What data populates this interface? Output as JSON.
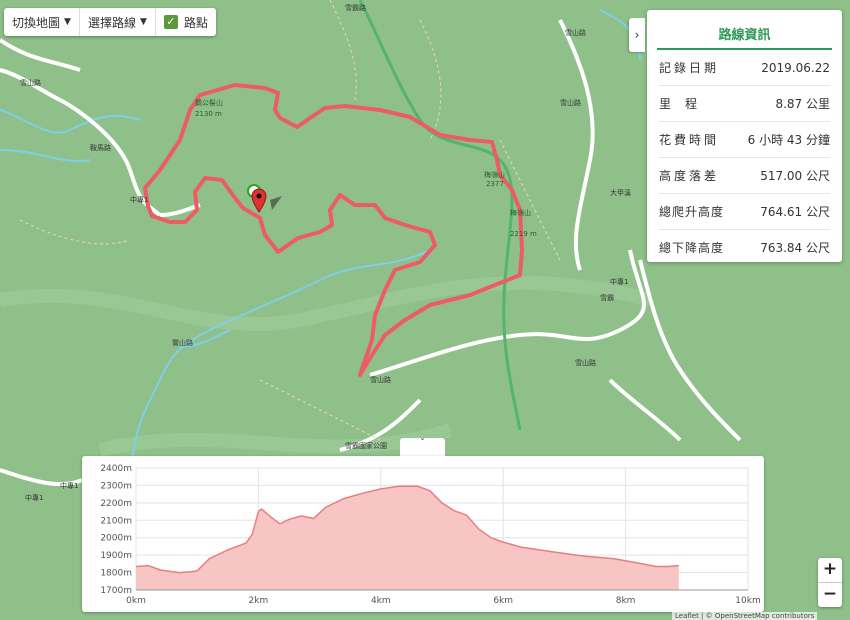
{
  "toolbar": {
    "switch_map": "切換地圖",
    "select_route": "選擇路線",
    "waypoints": "路點"
  },
  "panel": {
    "toggle": "›",
    "title": "路線資訊",
    "rows": [
      {
        "label": "記錄日期",
        "value": "2019.06.22"
      },
      {
        "label": "里程",
        "value": "8.87 公里"
      },
      {
        "label": "花費時間",
        "value": "6 小時 43 分鐘"
      },
      {
        "label": "高度落差",
        "value": "517.00 公尺"
      },
      {
        "label": "總爬升高度",
        "value": "764.61 公尺"
      },
      {
        "label": "總下降高度",
        "value": "763.84 公尺"
      }
    ]
  },
  "map_labels": {
    "peak1_name": "鵝公髻山",
    "peak1_elev": "2130 m",
    "peak2_name": "梅嶺山",
    "peak2_elev": "2377",
    "peak3_name": "梅嶺山",
    "peak3_elev": "2219 m",
    "road_a": "中專1",
    "road_b": "中專1",
    "road_c": "雪山路",
    "road_d": "雪山路",
    "road_e": "鸞山路",
    "road_f": "雪山路",
    "road_g": "鞍馬路",
    "road_h": "雪霸路",
    "road_i": "雪山路",
    "road_j": "大甲溪",
    "road_k": "雪霸國家公園",
    "road_l": "雪山路",
    "road_m": "中專1",
    "road_n": "中專1",
    "road_o": "雪霸"
  },
  "elevation": {
    "toggle": "ˇ",
    "y_ticks": [
      "2400m",
      "2300m",
      "2200m",
      "2100m",
      "2000m",
      "1900m",
      "1800m",
      "1700m"
    ],
    "x_ticks": [
      "0km",
      "2km",
      "4km",
      "6km",
      "8km",
      "10km"
    ]
  },
  "chart_data": {
    "type": "area",
    "xlabel": "",
    "ylabel": "",
    "xlim": [
      0,
      10
    ],
    "ylim": [
      1700,
      2400
    ],
    "x": [
      0,
      0.2,
      0.4,
      0.7,
      0.9,
      1.0,
      1.2,
      1.5,
      1.8,
      1.9,
      2.0,
      2.05,
      2.2,
      2.35,
      2.5,
      2.7,
      2.9,
      3.1,
      3.4,
      3.7,
      4.0,
      4.3,
      4.6,
      4.8,
      5.0,
      5.2,
      5.4,
      5.6,
      5.8,
      6.0,
      6.3,
      6.8,
      7.3,
      7.8,
      8.2,
      8.5,
      8.7,
      8.87
    ],
    "y": [
      1835,
      1840,
      1815,
      1800,
      1805,
      1810,
      1880,
      1930,
      1970,
      2020,
      2150,
      2165,
      2120,
      2080,
      2105,
      2125,
      2110,
      2175,
      2225,
      2255,
      2280,
      2295,
      2295,
      2270,
      2200,
      2155,
      2130,
      2050,
      2000,
      1975,
      1945,
      1920,
      1895,
      1880,
      1855,
      1835,
      1835,
      1840
    ],
    "series": [
      {
        "values": [
          1835,
          1840,
          1815,
          1800,
          1805,
          1810,
          1880,
          1930,
          1970,
          2020,
          2150,
          2165,
          2120,
          2080,
          2105,
          2125,
          2110,
          2175,
          2225,
          2255,
          2280,
          2295,
          2295,
          2270,
          2200,
          2155,
          2130,
          2050,
          2000,
          1975,
          1945,
          1920,
          1895,
          1880,
          1855,
          1835,
          1835,
          1840
        ]
      }
    ],
    "colors": {
      "fill": "#f8c5c5",
      "line": "#ea7d7d"
    },
    "grid": true
  },
  "zoom": {
    "in": "+",
    "out": "−"
  },
  "attribution": "Leaflet | © OpenStreetMap contributors"
}
